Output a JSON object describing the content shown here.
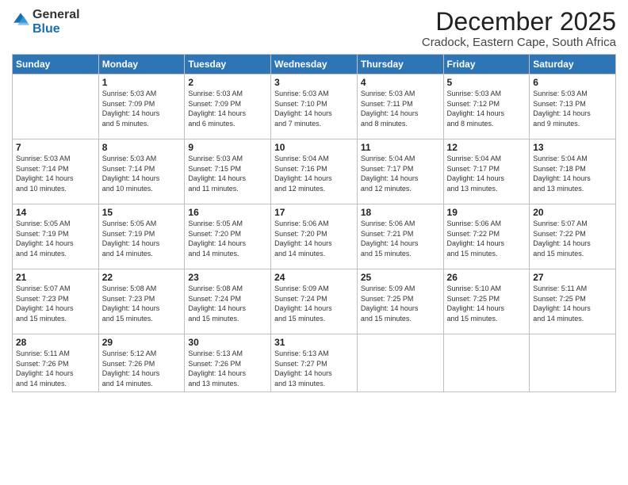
{
  "logo": {
    "general": "General",
    "blue": "Blue"
  },
  "title": "December 2025",
  "subtitle": "Cradock, Eastern Cape, South Africa",
  "weekdays": [
    "Sunday",
    "Monday",
    "Tuesday",
    "Wednesday",
    "Thursday",
    "Friday",
    "Saturday"
  ],
  "weeks": [
    [
      {
        "day": "",
        "info": ""
      },
      {
        "day": "1",
        "info": "Sunrise: 5:03 AM\nSunset: 7:09 PM\nDaylight: 14 hours\nand 5 minutes."
      },
      {
        "day": "2",
        "info": "Sunrise: 5:03 AM\nSunset: 7:09 PM\nDaylight: 14 hours\nand 6 minutes."
      },
      {
        "day": "3",
        "info": "Sunrise: 5:03 AM\nSunset: 7:10 PM\nDaylight: 14 hours\nand 7 minutes."
      },
      {
        "day": "4",
        "info": "Sunrise: 5:03 AM\nSunset: 7:11 PM\nDaylight: 14 hours\nand 8 minutes."
      },
      {
        "day": "5",
        "info": "Sunrise: 5:03 AM\nSunset: 7:12 PM\nDaylight: 14 hours\nand 8 minutes."
      },
      {
        "day": "6",
        "info": "Sunrise: 5:03 AM\nSunset: 7:13 PM\nDaylight: 14 hours\nand 9 minutes."
      }
    ],
    [
      {
        "day": "7",
        "info": ""
      },
      {
        "day": "8",
        "info": "Sunrise: 5:03 AM\nSunset: 7:14 PM\nDaylight: 14 hours\nand 10 minutes."
      },
      {
        "day": "9",
        "info": "Sunrise: 5:03 AM\nSunset: 7:15 PM\nDaylight: 14 hours\nand 11 minutes."
      },
      {
        "day": "10",
        "info": "Sunrise: 5:04 AM\nSunset: 7:16 PM\nDaylight: 14 hours\nand 12 minutes."
      },
      {
        "day": "11",
        "info": "Sunrise: 5:04 AM\nSunset: 7:17 PM\nDaylight: 14 hours\nand 12 minutes."
      },
      {
        "day": "12",
        "info": "Sunrise: 5:04 AM\nSunset: 7:17 PM\nDaylight: 14 hours\nand 13 minutes."
      },
      {
        "day": "13",
        "info": "Sunrise: 5:04 AM\nSunset: 7:18 PM\nDaylight: 14 hours\nand 13 minutes."
      }
    ],
    [
      {
        "day": "14",
        "info": ""
      },
      {
        "day": "15",
        "info": "Sunrise: 5:05 AM\nSunset: 7:19 PM\nDaylight: 14 hours\nand 14 minutes."
      },
      {
        "day": "16",
        "info": "Sunrise: 5:05 AM\nSunset: 7:20 PM\nDaylight: 14 hours\nand 14 minutes."
      },
      {
        "day": "17",
        "info": "Sunrise: 5:06 AM\nSunset: 7:20 PM\nDaylight: 14 hours\nand 14 minutes."
      },
      {
        "day": "18",
        "info": "Sunrise: 5:06 AM\nSunset: 7:21 PM\nDaylight: 14 hours\nand 15 minutes."
      },
      {
        "day": "19",
        "info": "Sunrise: 5:06 AM\nSunset: 7:22 PM\nDaylight: 14 hours\nand 15 minutes."
      },
      {
        "day": "20",
        "info": "Sunrise: 5:07 AM\nSunset: 7:22 PM\nDaylight: 14 hours\nand 15 minutes."
      }
    ],
    [
      {
        "day": "21",
        "info": ""
      },
      {
        "day": "22",
        "info": "Sunrise: 5:08 AM\nSunset: 7:23 PM\nDaylight: 14 hours\nand 15 minutes."
      },
      {
        "day": "23",
        "info": "Sunrise: 5:08 AM\nSunset: 7:24 PM\nDaylight: 14 hours\nand 15 minutes."
      },
      {
        "day": "24",
        "info": "Sunrise: 5:09 AM\nSunset: 7:24 PM\nDaylight: 14 hours\nand 15 minutes."
      },
      {
        "day": "25",
        "info": "Sunrise: 5:09 AM\nSunset: 7:25 PM\nDaylight: 14 hours\nand 15 minutes."
      },
      {
        "day": "26",
        "info": "Sunrise: 5:10 AM\nSunset: 7:25 PM\nDaylight: 14 hours\nand 15 minutes."
      },
      {
        "day": "27",
        "info": "Sunrise: 5:11 AM\nSunset: 7:25 PM\nDaylight: 14 hours\nand 14 minutes."
      }
    ],
    [
      {
        "day": "28",
        "info": "Sunrise: 5:11 AM\nSunset: 7:26 PM\nDaylight: 14 hours\nand 14 minutes."
      },
      {
        "day": "29",
        "info": "Sunrise: 5:12 AM\nSunset: 7:26 PM\nDaylight: 14 hours\nand 14 minutes."
      },
      {
        "day": "30",
        "info": "Sunrise: 5:13 AM\nSunset: 7:26 PM\nDaylight: 14 hours\nand 13 minutes."
      },
      {
        "day": "31",
        "info": "Sunrise: 5:13 AM\nSunset: 7:27 PM\nDaylight: 14 hours\nand 13 minutes."
      },
      {
        "day": "",
        "info": ""
      },
      {
        "day": "",
        "info": ""
      },
      {
        "day": "",
        "info": ""
      }
    ]
  ],
  "week1_sunday_info": "Sunrise: 5:03 AM\nSunset: 7:14 PM\nDaylight: 14 hours\nand 10 minutes.",
  "week3_sunday_info": "Sunrise: 5:05 AM\nSunset: 7:19 PM\nDaylight: 14 hours\nand 14 minutes.",
  "week4_sunday_info": "Sunrise: 5:07 AM\nSunset: 7:23 PM\nDaylight: 14 hours\nand 15 minutes."
}
